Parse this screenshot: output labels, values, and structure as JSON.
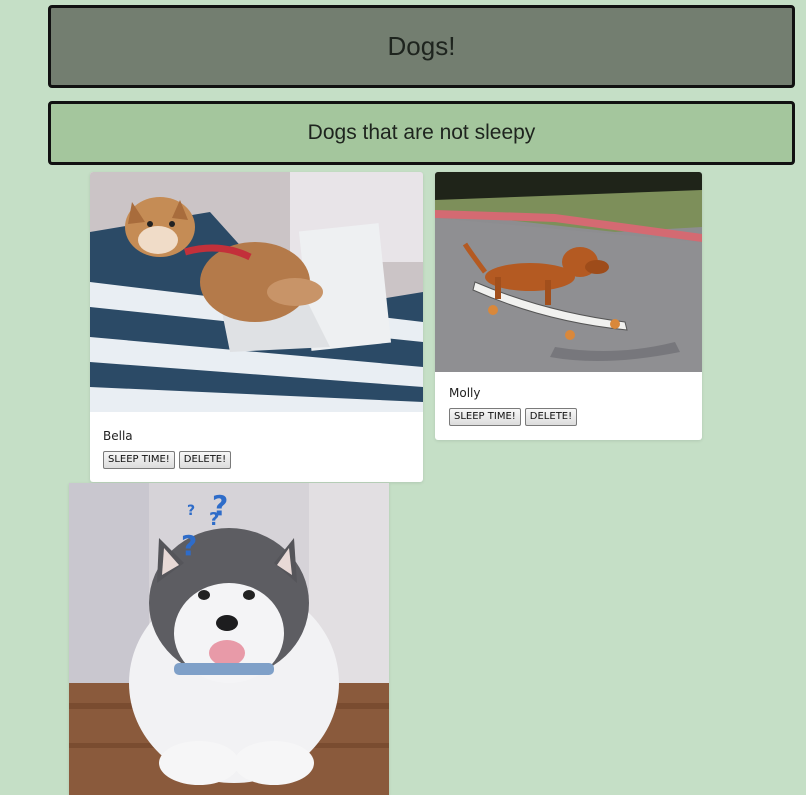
{
  "header": {
    "title": "Dogs!"
  },
  "section": {
    "title": "Dogs that are not sleepy"
  },
  "dogs": [
    {
      "name": "Bella",
      "sleep_label": "SLEEP TIME!",
      "delete_label": "DELETE!"
    },
    {
      "name": "Molly",
      "sleep_label": "SLEEP TIME!",
      "delete_label": "DELETE!"
    }
  ]
}
